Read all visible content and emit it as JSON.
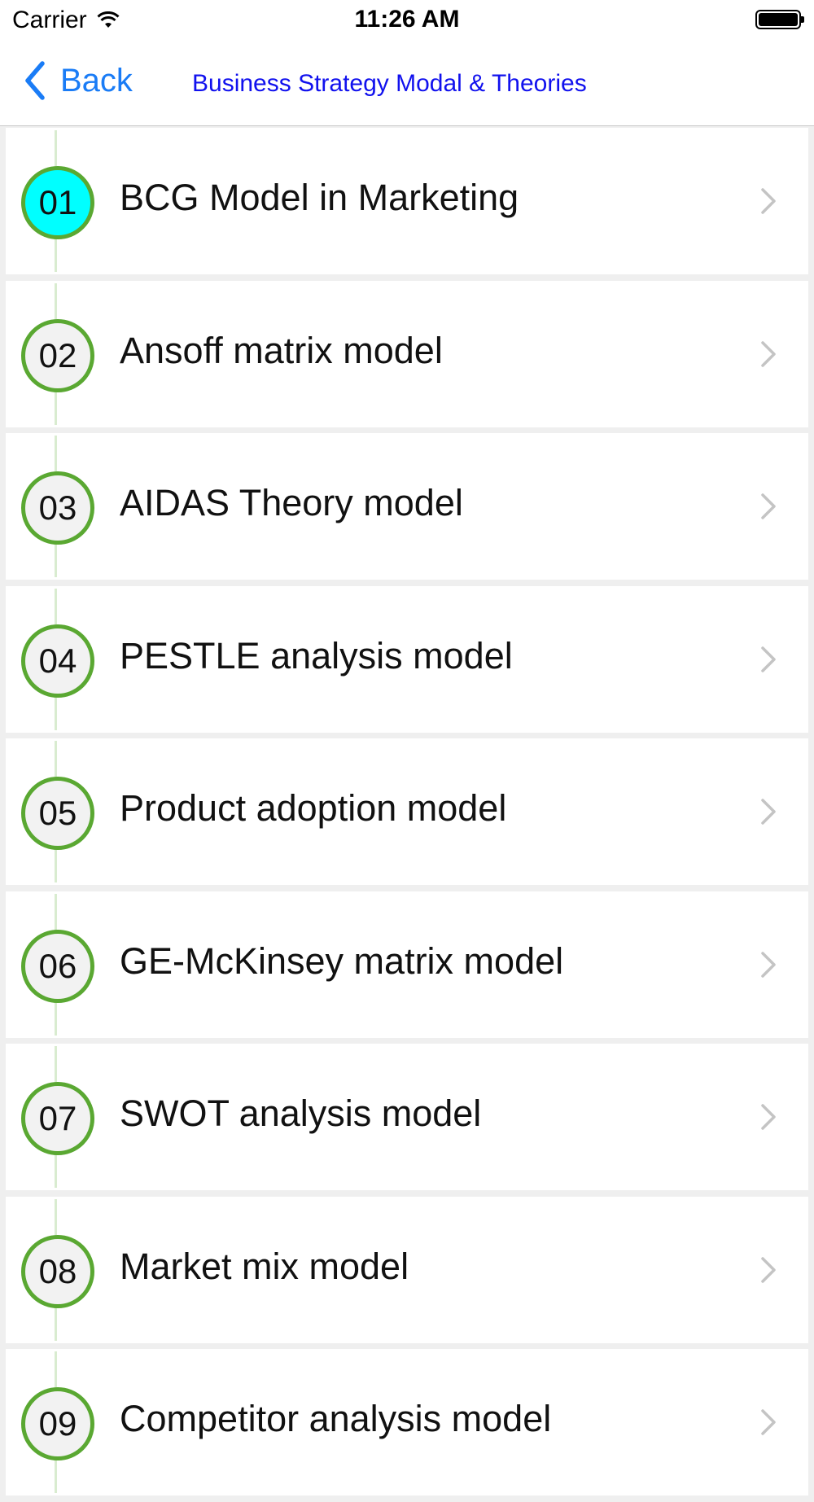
{
  "status_bar": {
    "carrier": "Carrier",
    "time": "11:26 AM"
  },
  "nav": {
    "back_label": "Back",
    "title": "Business Strategy Modal & Theories"
  },
  "colors": {
    "accent": "#1a7cf6",
    "title": "#1111ee",
    "circle_border": "#5aa832",
    "active_circle": "#00ffff"
  },
  "items": [
    {
      "number": "01",
      "label": "BCG Model in Marketing",
      "active": true
    },
    {
      "number": "02",
      "label": "Ansoff matrix model",
      "active": false
    },
    {
      "number": "03",
      "label": "AIDAS Theory model",
      "active": false
    },
    {
      "number": "04",
      "label": "PESTLE analysis model",
      "active": false
    },
    {
      "number": "05",
      "label": "Product adoption model",
      "active": false
    },
    {
      "number": "06",
      "label": "GE-McKinsey matrix model",
      "active": false
    },
    {
      "number": "07",
      "label": "SWOT analysis model",
      "active": false
    },
    {
      "number": "08",
      "label": "Market mix model",
      "active": false
    },
    {
      "number": "09",
      "label": "Competitor analysis model",
      "active": false
    }
  ]
}
